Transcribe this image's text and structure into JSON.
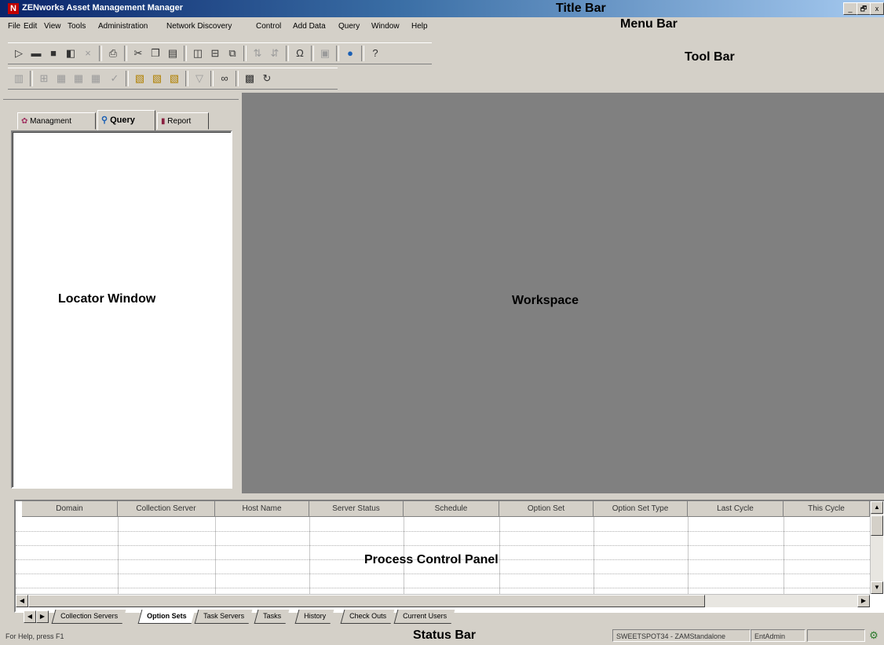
{
  "window": {
    "title": "ZENworks Asset Management Manager",
    "app_icon_letter": "N",
    "controls": [
      "_",
      "🗗",
      "x"
    ]
  },
  "menu": {
    "items": [
      "File",
      "Edit",
      "View",
      "Tools",
      "Administration",
      "Network Discovery",
      "Control",
      "Add Data",
      "Query",
      "Window",
      "Help"
    ]
  },
  "toolbar1": [
    "new-icon",
    "open-icon",
    "save-icon",
    "copy-doc-icon",
    "close-icon",
    "print-icon",
    "cut-icon",
    "copy-icon",
    "paste-icon",
    "panel-left-icon",
    "panel-split-icon",
    "panel-export-icon",
    "sort-asc-icon",
    "sort-desc-icon",
    "omega-icon",
    "page-icon",
    "globe-icon",
    "help-icon"
  ],
  "toolbar2": [
    "tb2-a-icon",
    "tb2-b-icon",
    "tb2-c-icon",
    "tb2-d-icon",
    "tb2-e-icon",
    "check-icon",
    "query-new-icon",
    "query-open-icon",
    "query-save-icon",
    "filter-icon",
    "binoculars-icon",
    "report-icon",
    "refresh-icon"
  ],
  "locator": {
    "tabs": [
      {
        "label": "Managment",
        "icon": "management-icon"
      },
      {
        "label": "Query",
        "icon": "magnifier-icon"
      },
      {
        "label": "Report",
        "icon": "report-chart-icon"
      }
    ],
    "active_tab": "Query"
  },
  "process_panel": {
    "columns": [
      "Domain",
      "Collection Server",
      "Host Name",
      "Server Status",
      "Schedule",
      "Option Set",
      "Option Set Type",
      "Last Cycle",
      "This Cycle"
    ]
  },
  "bottom_tabs": [
    "Collection Servers",
    "Option Sets",
    "Task Servers",
    "Tasks",
    "History",
    "Check Outs",
    "Current Users"
  ],
  "bottom_tabs_active": "Option Sets",
  "status": {
    "left": "For Help, press F1",
    "server": "SWEETSPOT34 - ZAMStandalone",
    "user": "EntAdmin"
  },
  "annotations": {
    "title_bar": "Title Bar",
    "menu_bar": "Menu Bar",
    "tool_bar": "Tool Bar",
    "locator_window": "Locator Window",
    "workspace": "Workspace",
    "process_control_panel": "Process Control Panel",
    "status_bar": "Status Bar"
  }
}
